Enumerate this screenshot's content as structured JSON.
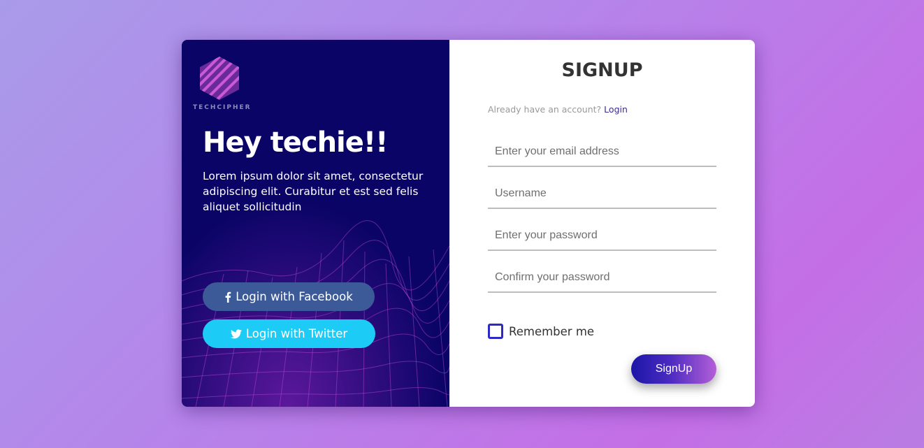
{
  "brand": {
    "logo_text": "TECHCIPHER"
  },
  "hero": {
    "title": "Hey techie!!",
    "text": "Lorem ipsum dolor sit amet, consectetur adipiscing elit. Curabitur et est sed felis aliquet sollicitudin"
  },
  "social": {
    "facebook_label": "Login with Facebook",
    "twitter_label": "Login with Twitter",
    "facebook_color": "#3d5a98",
    "twitter_color": "#1ccbf6"
  },
  "form": {
    "title": "SIGNUP",
    "already_text": "Already have an account?",
    "login_link": "Login",
    "email_placeholder": "Enter your email address",
    "username_placeholder": "Username",
    "password_placeholder": "Enter your password",
    "confirm_placeholder": "Confirm your password",
    "remember_label": "Remember me",
    "remember_checked": false,
    "signup_label": "SignUp"
  },
  "colors": {
    "left_panel": "#0a0466",
    "accent": "#2f29c4",
    "signup_gradient_start": "#1b16a8",
    "signup_gradient_end": "#b45fd8"
  },
  "icons": {
    "logo": "hexagon-logo-icon",
    "facebook": "facebook-icon",
    "twitter": "twitter-icon"
  }
}
